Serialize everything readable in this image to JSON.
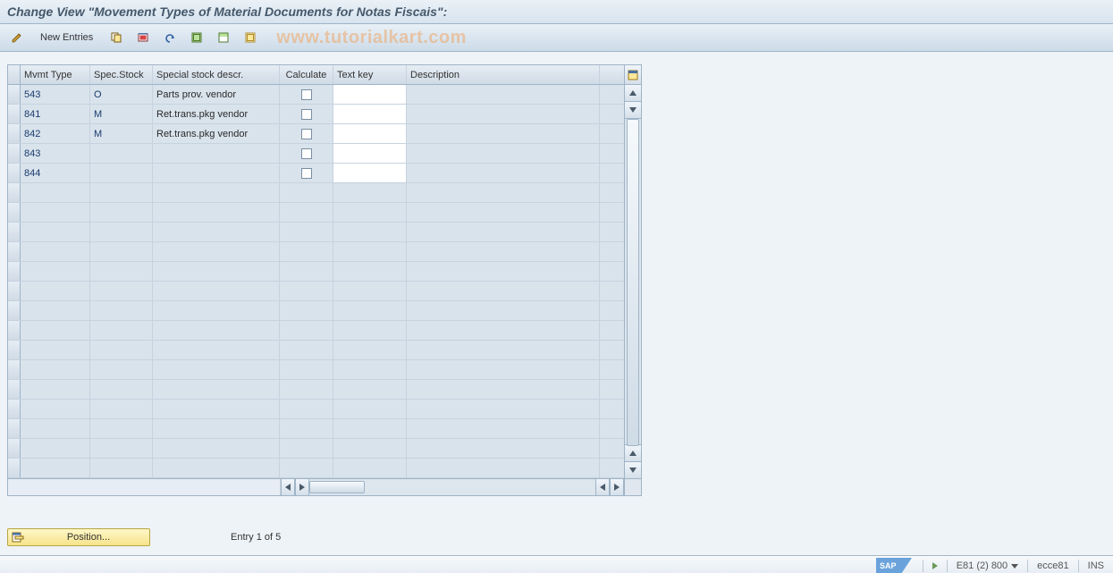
{
  "title": "Change View \"Movement Types of Material Documents for Notas Fiscais\":",
  "watermark": "www.tutorialkart.com",
  "toolbar": {
    "new_entries_label": "New Entries",
    "icons": {
      "toggle": "toggle-change-display-icon",
      "copy": "copy-as-icon",
      "delete": "delete-icon",
      "undo": "undo-change-icon",
      "select_all": "select-all-icon",
      "select_block": "select-block-icon",
      "deselect_all": "deselect-all-icon"
    }
  },
  "table": {
    "columns": {
      "mvmt": "Mvmt Type",
      "spec": "Spec.Stock",
      "descr": "Special stock descr.",
      "calc": "Calculate",
      "tkey": "Text key",
      "desc2": "Description"
    },
    "rows": [
      {
        "mvmt": "543",
        "spec": "O",
        "descr": "Parts prov. vendor",
        "calc": false,
        "tkey": "",
        "desc2": ""
      },
      {
        "mvmt": "841",
        "spec": "M",
        "descr": "Ret.trans.pkg vendor",
        "calc": false,
        "tkey": "",
        "desc2": ""
      },
      {
        "mvmt": "842",
        "spec": "M",
        "descr": "Ret.trans.pkg vendor",
        "calc": false,
        "tkey": "",
        "desc2": ""
      },
      {
        "mvmt": "843",
        "spec": "",
        "descr": "",
        "calc": false,
        "tkey": "",
        "desc2": ""
      },
      {
        "mvmt": "844",
        "spec": "",
        "descr": "",
        "calc": false,
        "tkey": "",
        "desc2": ""
      }
    ],
    "empty_rows": 15
  },
  "footer": {
    "position_label": "Position...",
    "entry_text": "Entry 1 of 5"
  },
  "statusbar": {
    "session": "E81 (2) 800",
    "server": "ecce81",
    "mode": "INS"
  }
}
